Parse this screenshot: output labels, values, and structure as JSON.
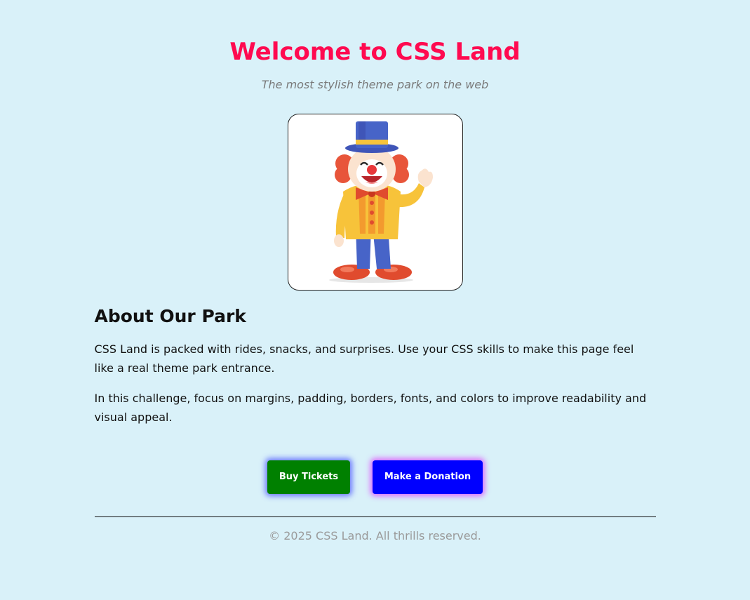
{
  "header": {
    "title": "Welcome to CSS Land",
    "tagline": "The most stylish theme park on the web"
  },
  "mascot": {
    "icon": "clown-icon"
  },
  "about": {
    "heading": "About Our Park",
    "paragraphs": [
      "CSS Land is packed with rides, snacks, and surprises. Use your CSS skills to make this page feel like a real theme park entrance.",
      "In this challenge, focus on margins, padding, borders, fonts, and colors to improve readability and visual appeal."
    ]
  },
  "actions": {
    "buy_label": "Buy Tickets",
    "donate_label": "Make a Donation"
  },
  "footer": {
    "text": "© 2025 CSS Land. All thrills reserved."
  },
  "colors": {
    "background": "#d9f1f9",
    "title": "#ff0a50",
    "buy_button": "#008000",
    "donate_button": "#0000ff"
  }
}
